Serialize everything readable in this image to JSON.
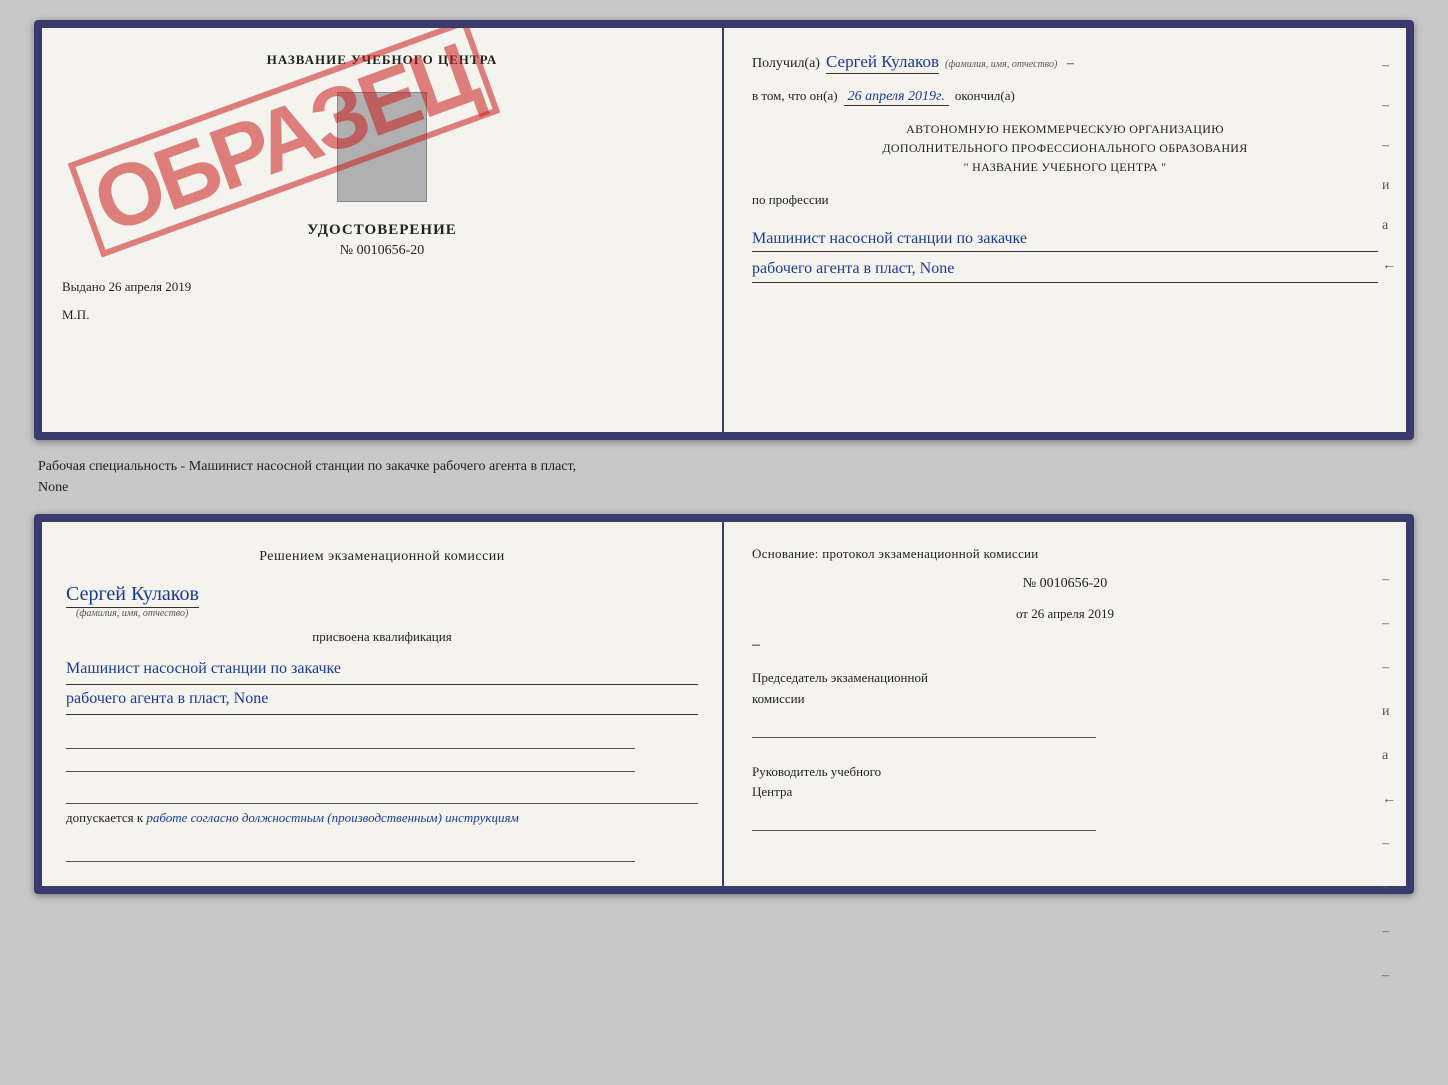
{
  "page": {
    "background": "#c8c8c8"
  },
  "top_left": {
    "title": "НАЗВАНИЕ УЧЕБНОГО ЦЕНТРА",
    "stamp": "ОБРАЗЕЦ",
    "udostoverenie_label": "УДОСТОВЕРЕНИЕ",
    "number": "№ 0010656-20",
    "vydano": "Выдано 26 апреля 2019",
    "mp": "М.П."
  },
  "top_right": {
    "poluchil_label": "Получил(а)",
    "poluchil_name": "Сергей Кулаков",
    "poluchil_subtitle": "(фамилия, имя, отчество)",
    "vtom_label": "в том, что он(а)",
    "date": "26 апреля 2019г.",
    "okonchil": "окончил(а)",
    "org_line1": "АВТОНОМНУЮ НЕКОММЕРЧЕСКУЮ ОРГАНИЗАЦИЮ",
    "org_line2": "ДОПОЛНИТЕЛЬНОГО ПРОФЕССИОНАЛЬНОГО ОБРАЗОВАНИЯ",
    "org_line3": "\"  НАЗВАНИЕ УЧЕБНОГО ЦЕНТРА  \"",
    "po_professii": "по профессии",
    "profession_line1": "Машинист насосной станции по закачке",
    "profession_line2": "рабочего агента в пласт, None"
  },
  "middle": {
    "text_line1": "Рабочая специальность - Машинист насосной станции по закачке рабочего агента в пласт,",
    "text_line2": "None"
  },
  "bottom_left": {
    "reshen_text": "Решением экзаменационной комиссии",
    "name": "Сергей Кулаков",
    "name_subtitle": "(фамилия, имя, отчество)",
    "prisvoena": "присвоена квалификация",
    "kvali_line1": "Машинист насосной станции по закачке",
    "kvali_line2": "рабочего агента в пласт, None",
    "dopuskaetsya_prefix": "допускается к",
    "dopuskaetsya_text": "работе согласно должностным (производственным) инструкциям"
  },
  "bottom_right": {
    "osnovanie": "Основание: протокол экзаменационной комиссии",
    "protocol_number": "№ 0010656-20",
    "ot_prefix": "от",
    "ot_date": "26 апреля 2019",
    "predsedatel_line1": "Председатель экзаменационной",
    "predsedatel_line2": "комиссии",
    "rukovoditel_line1": "Руководитель учебного",
    "rukovoditel_line2": "Центра"
  },
  "dashes_right_top": [
    "-",
    "-",
    "-",
    "-",
    "и",
    "а",
    "←"
  ],
  "dashes_right_bottom": [
    "-",
    "-",
    "-",
    "-",
    "и",
    "а",
    "←",
    "-",
    "-",
    "-",
    "-"
  ]
}
